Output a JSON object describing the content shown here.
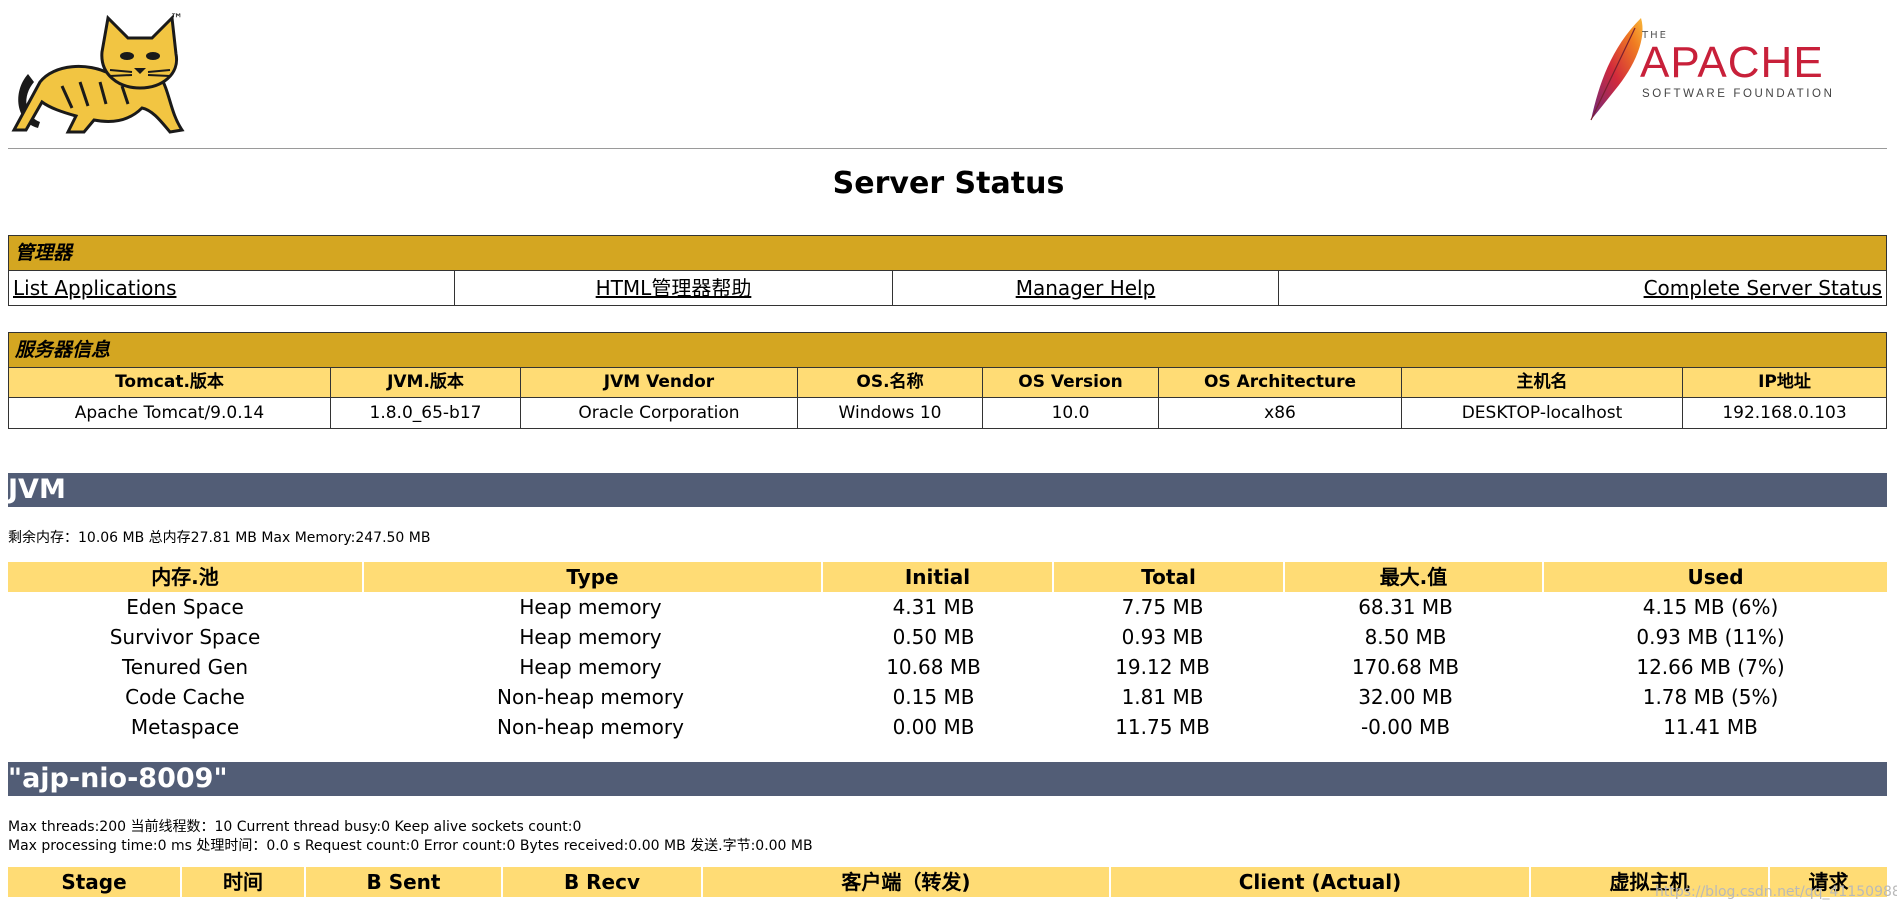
{
  "header": {
    "tomcat_tm": "™",
    "apache_the": "THE",
    "apache_name": "APACHE",
    "apache_sub": "SOFTWARE FOUNDATION"
  },
  "page_title": "Server Status",
  "manager": {
    "title": "管理器",
    "links": [
      "List Applications",
      "HTML管理器帮助",
      "Manager Help",
      "Complete Server Status"
    ]
  },
  "server_info": {
    "title": "服务器信息",
    "headers": [
      "Tomcat.版本",
      "JVM.版本",
      "JVM Vendor",
      "OS.名称",
      "OS Version",
      "OS Architecture",
      "主机名",
      "IP地址"
    ],
    "values": [
      "Apache Tomcat/9.0.14",
      "1.8.0_65-b17",
      "Oracle Corporation",
      "Windows 10",
      "10.0",
      "x86",
      "DESKTOP-localhost",
      "192.168.0.103"
    ]
  },
  "jvm": {
    "title": "JVM",
    "memory_summary": "剩余内存：10.06 MB 总内存27.81 MB Max Memory:247.50 MB",
    "headers": [
      "内存.池",
      "Type",
      "Initial",
      "Total",
      "最大.值",
      "Used"
    ],
    "rows": [
      [
        "Eden Space",
        "Heap memory",
        "4.31 MB",
        "7.75 MB",
        "68.31 MB",
        "4.15 MB (6%)"
      ],
      [
        "Survivor Space",
        "Heap memory",
        "0.50 MB",
        "0.93 MB",
        "8.50 MB",
        "0.93 MB (11%)"
      ],
      [
        "Tenured Gen",
        "Heap memory",
        "10.68 MB",
        "19.12 MB",
        "170.68 MB",
        "12.66 MB (7%)"
      ],
      [
        "Code Cache",
        "Non-heap memory",
        "0.15 MB",
        "1.81 MB",
        "32.00 MB",
        "1.78 MB (5%)"
      ],
      [
        "Metaspace",
        "Non-heap memory",
        "0.00 MB",
        "11.75 MB",
        "-0.00 MB",
        "11.41 MB"
      ]
    ]
  },
  "connector": {
    "title": "\"ajp-nio-8009\"",
    "line1": "Max threads:200 当前线程数：10 Current thread busy:0 Keep alive sockets count:0",
    "line2": "Max processing time:0 ms 处理时间：0.0 s Request count:0 Error count:0 Bytes received:0.00 MB 发送.字节:0.00 MB",
    "headers": [
      "Stage",
      "时间",
      "B Sent",
      "B Recv",
      "客户端（转发)",
      "Client (Actual)",
      "虚拟主机",
      "请求"
    ]
  },
  "watermark": "https://blog.csdn.net/qq_41150988",
  "colors": {
    "gold_header": "#d4a621",
    "light_gold": "#ffdc75",
    "section_bar": "#525d76"
  }
}
